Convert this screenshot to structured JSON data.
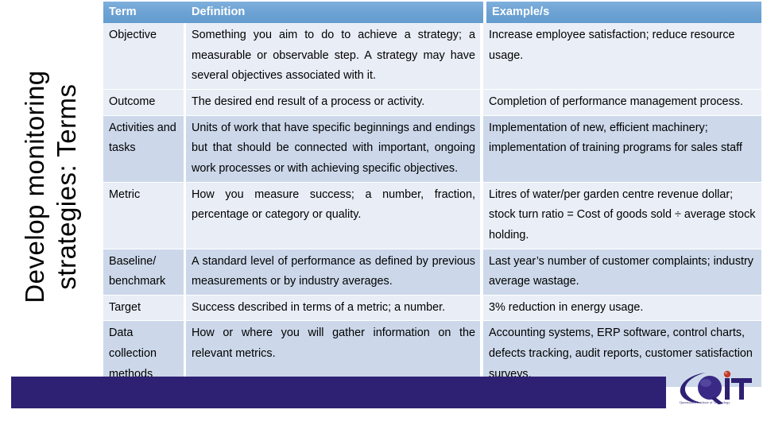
{
  "slide": {
    "title": "Develop monitoring\nstrategies: Terms",
    "title_line1": "Develop monitoring",
    "title_line2": "strategies: Terms"
  },
  "colors": {
    "header_blue": "#6ea3d4",
    "band_light": "#e8edf6",
    "band_dark": "#ccd8ea",
    "footer_purple": "#2e2073",
    "logo_navy": "#2e2073",
    "logo_accent_red": "#c0392b"
  },
  "table": {
    "columns": [
      "Term",
      "Definition",
      "Example/s"
    ],
    "rows": [
      {
        "term": "Objective",
        "definition": "Something you aim to do to achieve a strategy; a measurable or observable step. A strategy may have several objectives associated with it.",
        "example": "Increase employee satisfaction; reduce resource usage."
      },
      {
        "term": "Outcome",
        "definition": "The desired end result of a process or activity.",
        "example": "Completion of performance management process."
      },
      {
        "term": "Activities and tasks",
        "definition": "Units of work that have specific beginnings and endings but that should be connected with important, ongoing work processes or with achieving specific objectives.",
        "example": "Implementation of new, efficient machinery; implementation of training programs for sales staff"
      },
      {
        "term": "Metric",
        "definition": "How you measure success; a number, fraction, percentage or category or quality.",
        "example": "Litres of water/per garden centre revenue dollar; stock turn ratio = Cost of goods sold ÷ average stock holding."
      },
      {
        "term": "Baseline/ benchmark",
        "definition": "A standard level of performance as defined by previous measurements or by industry averages.",
        "example": "Last year’s number of customer complaints; industry average wastage."
      },
      {
        "term": "Target",
        "definition": "Success described in terms of a metric; a number.",
        "example": "3% reduction in energy usage."
      },
      {
        "term": "Data collection methods",
        "definition": "How or where you will gather information on the relevant metrics.",
        "example": "Accounting systems, ERP software, control charts, defects tracking, audit reports, customer satisfaction surveys."
      }
    ]
  },
  "logo": {
    "name": "QIT",
    "letters": "IT",
    "tagline": "Queensland Institute of Technology"
  }
}
